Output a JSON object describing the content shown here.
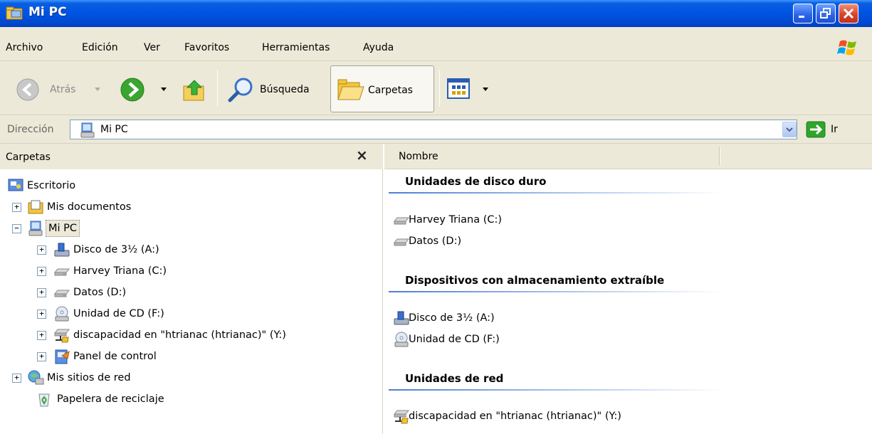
{
  "window": {
    "title": "Mi PC"
  },
  "menu": {
    "items": [
      "Archivo",
      "Edición",
      "Ver",
      "Favoritos",
      "Herramientas",
      "Ayuda"
    ]
  },
  "toolbar": {
    "back_label": "Atrás",
    "search_label": "Búsqueda",
    "folders_label": "Carpetas"
  },
  "address": {
    "label": "Dirección",
    "value": "Mi PC",
    "go_label": "Ir"
  },
  "folder_pane": {
    "title": "Carpetas",
    "close_glyph": "×",
    "tree": [
      {
        "label": "Escritorio",
        "icon": "desktop-icon"
      },
      {
        "label": "Mis documentos",
        "icon": "folder-icon",
        "expander": "+"
      },
      {
        "label": "Mi PC",
        "icon": "computer-icon",
        "expander": "−",
        "selected": true
      },
      {
        "label": "Disco de 3½ (A:)",
        "icon": "floppy-icon",
        "expander": "+"
      },
      {
        "label": "Harvey Triana (C:)",
        "icon": "hard-drive-icon",
        "expander": "+"
      },
      {
        "label": "Datos (D:)",
        "icon": "hard-drive-icon",
        "expander": "+"
      },
      {
        "label": "Unidad de CD (F:)",
        "icon": "cd-drive-icon",
        "expander": "+"
      },
      {
        "label": "discapacidad en \"htrianac (htrianac)\" (Y:)",
        "icon": "network-drive-icon",
        "expander": "+"
      },
      {
        "label": "Panel de control",
        "icon": "control-panel-icon",
        "expander": "+"
      },
      {
        "label": "Mis sitios de red",
        "icon": "network-places-icon",
        "expander": "+"
      },
      {
        "label": "Papelera de reciclaje",
        "icon": "recycle-bin-icon"
      }
    ]
  },
  "content": {
    "column_name": "Nombre",
    "groups": [
      {
        "title": "Unidades de disco duro",
        "items": [
          {
            "label": "Harvey Triana (C:)",
            "icon": "hard-drive-icon"
          },
          {
            "label": "Datos (D:)",
            "icon": "hard-drive-icon"
          }
        ]
      },
      {
        "title": "Dispositivos con almacenamiento extraíble",
        "items": [
          {
            "label": "Disco de 3½ (A:)",
            "icon": "floppy-icon"
          },
          {
            "label": "Unidad de CD (F:)",
            "icon": "cd-drive-icon"
          }
        ]
      },
      {
        "title": "Unidades de red",
        "items": [
          {
            "label": "discapacidad en \"htrianac (htrianac)\" (Y:)",
            "icon": "network-drive-icon"
          }
        ]
      }
    ]
  },
  "colors": {
    "title_bar": "#0054e3",
    "chrome": "#ece9d8",
    "group_line": "#4b7fd1",
    "close_button": "#d8442a"
  }
}
